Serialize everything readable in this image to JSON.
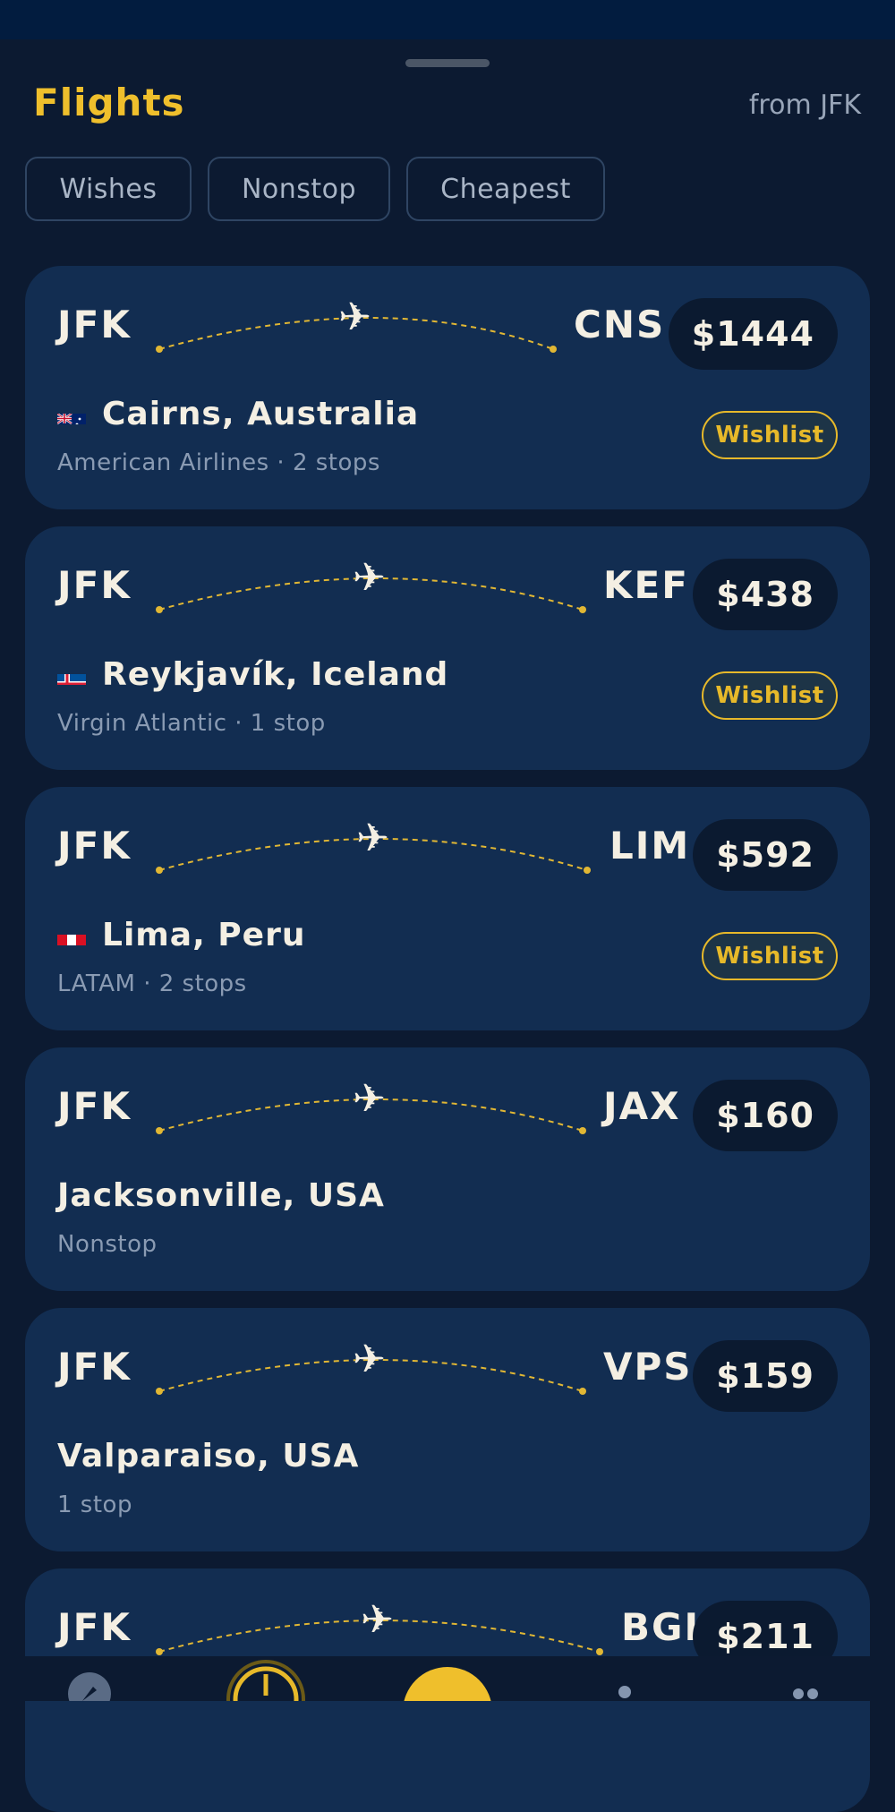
{
  "header": {
    "title": "Flights",
    "origin_label": "from JFK"
  },
  "filters": [
    {
      "label": "Wishes"
    },
    {
      "label": "Nonstop"
    },
    {
      "label": "Cheapest"
    }
  ],
  "flights": [
    {
      "from": "JFK",
      "to": "CNS",
      "price": "$1444",
      "city": "Cairns, Australia",
      "flag": "australia-flag",
      "details": "American Airlines · 2 stops",
      "wishlist_label": "Wishlist"
    },
    {
      "from": "JFK",
      "to": "KEF",
      "price": "$438",
      "city": "Reykjavík, Iceland",
      "flag": "iceland-flag",
      "details": "Virgin Atlantic · 1 stop",
      "wishlist_label": "Wishlist"
    },
    {
      "from": "JFK",
      "to": "LIM",
      "price": "$592",
      "city": "Lima, Peru",
      "flag": "peru-flag",
      "details": "LATAM · 2 stops",
      "wishlist_label": "Wishlist"
    },
    {
      "from": "JFK",
      "to": "JAX",
      "price": "$160",
      "city": "Jacksonville, USA",
      "details": "Nonstop"
    },
    {
      "from": "JFK",
      "to": "VPS",
      "price": "$159",
      "city": "Valparaiso, USA",
      "details": "1 stop"
    },
    {
      "from": "JFK",
      "to": "BGI",
      "price": "$211"
    }
  ],
  "tabbar": {
    "items": [
      {
        "icon": "compass-icon"
      },
      {
        "icon": "clock-icon"
      },
      {
        "icon": "center-action-icon"
      },
      {
        "icon": "profile-icon"
      },
      {
        "icon": "more-icon"
      }
    ]
  },
  "colors": {
    "accent": "#efbf2c",
    "card": "#122d51",
    "background": "#0c1a31"
  }
}
